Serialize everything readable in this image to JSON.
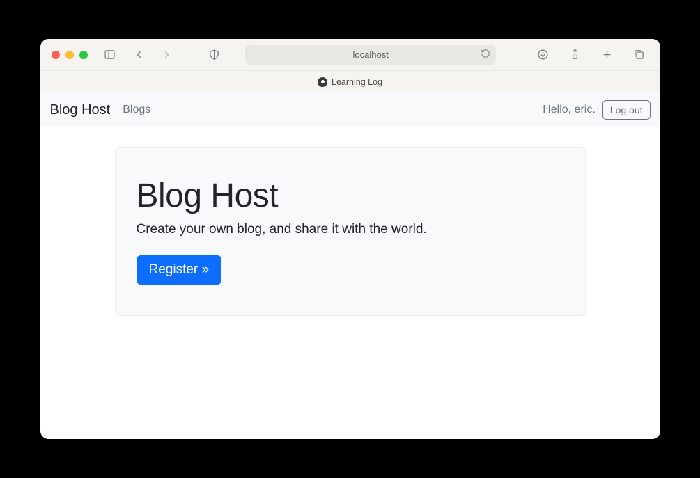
{
  "browser": {
    "address": "localhost",
    "tab_title": "Learning Log"
  },
  "navbar": {
    "brand": "Blog Host",
    "links": [
      {
        "label": "Blogs"
      }
    ],
    "greeting": "Hello, eric.",
    "logout_label": "Log out"
  },
  "hero": {
    "title": "Blog Host",
    "subtitle": "Create your own blog, and share it with the world.",
    "cta_label": "Register »"
  }
}
